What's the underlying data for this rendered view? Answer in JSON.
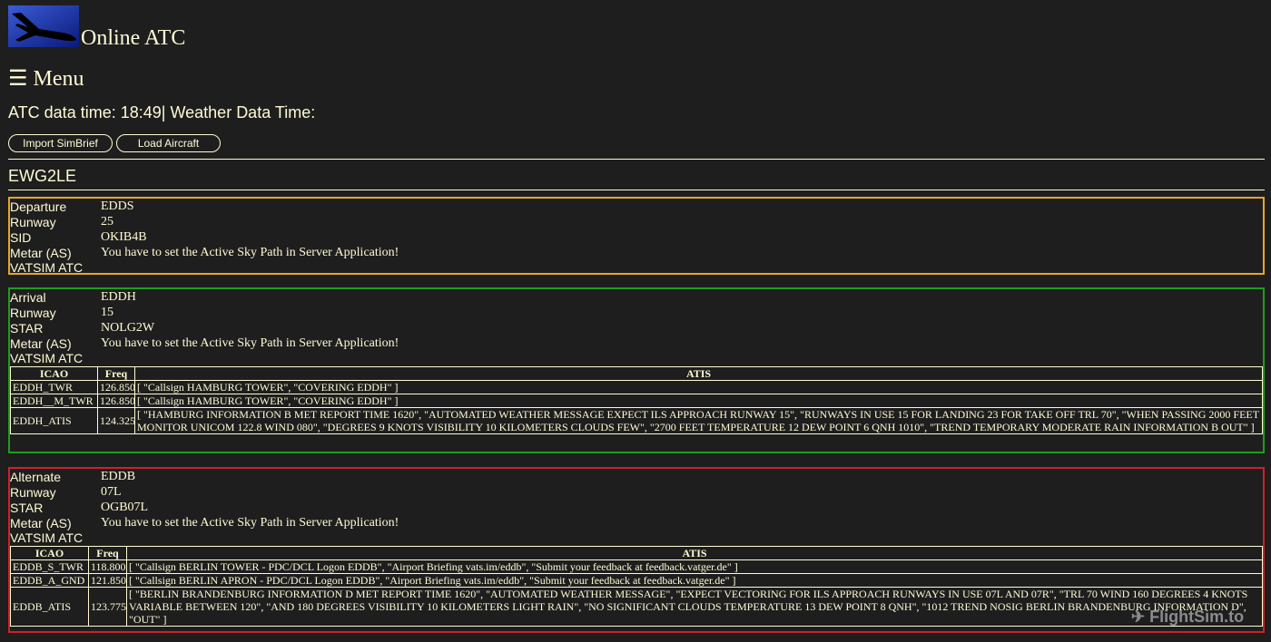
{
  "app": {
    "title": "Online ATC"
  },
  "menu": {
    "label": "☰ Menu"
  },
  "status": {
    "atc_label": "ATC data time:",
    "atc_time": "18:49",
    "separator": "|",
    "weather_label": "Weather Data Time:"
  },
  "toolbar": {
    "import_label": "Import SimBrief",
    "load_label": "Load Aircraft"
  },
  "flight": {
    "callsign": "EWG2LE"
  },
  "departure": {
    "heading": "Departure",
    "airport": "EDDS",
    "runway_label": "Runway",
    "runway": "25",
    "proc_label": "SID",
    "proc": "OKIB4B",
    "metar_label": "Metar (AS)",
    "metar": "You have to set the Active Sky Path in Server Application!",
    "atc_label": "VATSIM ATC"
  },
  "arrival": {
    "heading": "Arrival",
    "airport": "EDDH",
    "runway_label": "Runway",
    "runway": "15",
    "proc_label": "STAR",
    "proc": "NOLG2W",
    "metar_label": "Metar (AS)",
    "metar": "You have to set the Active Sky Path in Server Application!",
    "atc_label": "VATSIM ATC",
    "table": {
      "headers": [
        "ICAO",
        "Freq",
        "ATIS"
      ],
      "rows": [
        {
          "icao": "EDDH_TWR",
          "freq": "126.850",
          "atis": "[ \"Callsign HAMBURG TOWER\", \"COVERING EDDH\" ]"
        },
        {
          "icao": "EDDH__M_TWR",
          "freq": "126.850",
          "atis": "[ \"Callsign HAMBURG TOWER\", \"COVERING EDDH\" ]"
        },
        {
          "icao": "EDDH_ATIS",
          "freq": "124.325",
          "atis": "[ \"HAMBURG INFORMATION B MET REPORT TIME 1620\", \"AUTOMATED WEATHER MESSAGE EXPECT ILS APPROACH RUNWAY 15\", \"RUNWAYS IN USE 15 FOR LANDING 23 FOR TAKE OFF TRL 70\", \"WHEN PASSING 2000 FEET MONITOR UNICOM 122.8 WIND 080\", \"DEGREES 9 KNOTS VISIBILITY 10 KILOMETERS CLOUDS FEW\", \"2700 FEET TEMPERATURE 12 DEW POINT 6 QNH 1010\", \"TREND TEMPORARY MODERATE RAIN INFORMATION B OUT\" ]"
        }
      ]
    }
  },
  "alternate": {
    "heading": "Alternate",
    "airport": "EDDB",
    "runway_label": "Runway",
    "runway": "07L",
    "proc_label": "STAR",
    "proc": "OGB07L",
    "metar_label": "Metar (AS)",
    "metar": "You have to set the Active Sky Path in Server Application!",
    "atc_label": "VATSIM ATC",
    "table": {
      "headers": [
        "ICAO",
        "Freq",
        "ATIS"
      ],
      "rows": [
        {
          "icao": "EDDB_S_TWR",
          "freq": "118.800",
          "atis": "[ \"Callsign BERLIN TOWER - PDC/DCL Logon EDDB\", \"Airport Briefing vats.im/eddb\", \"Submit your feedback at feedback.vatger.de\" ]"
        },
        {
          "icao": "EDDB_A_GND",
          "freq": "121.850",
          "atis": "[ \"Callsign BERLIN APRON - PDC/DCL Logon EDDB\", \"Airport Briefing vats.im/eddb\", \"Submit your feedback at feedback.vatger.de\" ]"
        },
        {
          "icao": "EDDB_ATIS",
          "freq": "123.775",
          "atis": "[ \"BERLIN BRANDENBURG INFORMATION D MET REPORT TIME 1620\", \"AUTOMATED WEATHER MESSAGE\", \"EXPECT VECTORING FOR ILS APPROACH RUNWAYS IN USE 07L AND 07R\", \"TRL 70 WIND 160 DEGREES 4 KNOTS VARIABLE BETWEEN 120\", \"AND 180 DEGREES VISIBILITY 10 KILOMETERS LIGHT RAIN\", \"NO SIGNIFICANT CLOUDS TEMPERATURE 13 DEW POINT 8 QNH\", \"1012 TREND NOSIG BERLIN BRANDENBURG INFORMATION D\", \"OUT\" ]"
        }
      ]
    }
  },
  "watermark": {
    "text": "FlightSim.to"
  },
  "colors": {
    "background": "#1e1e1e",
    "text": "#fffbd5",
    "departure": "#e8a52a",
    "arrival": "#1f9d1f",
    "alternate": "#d1202a"
  }
}
